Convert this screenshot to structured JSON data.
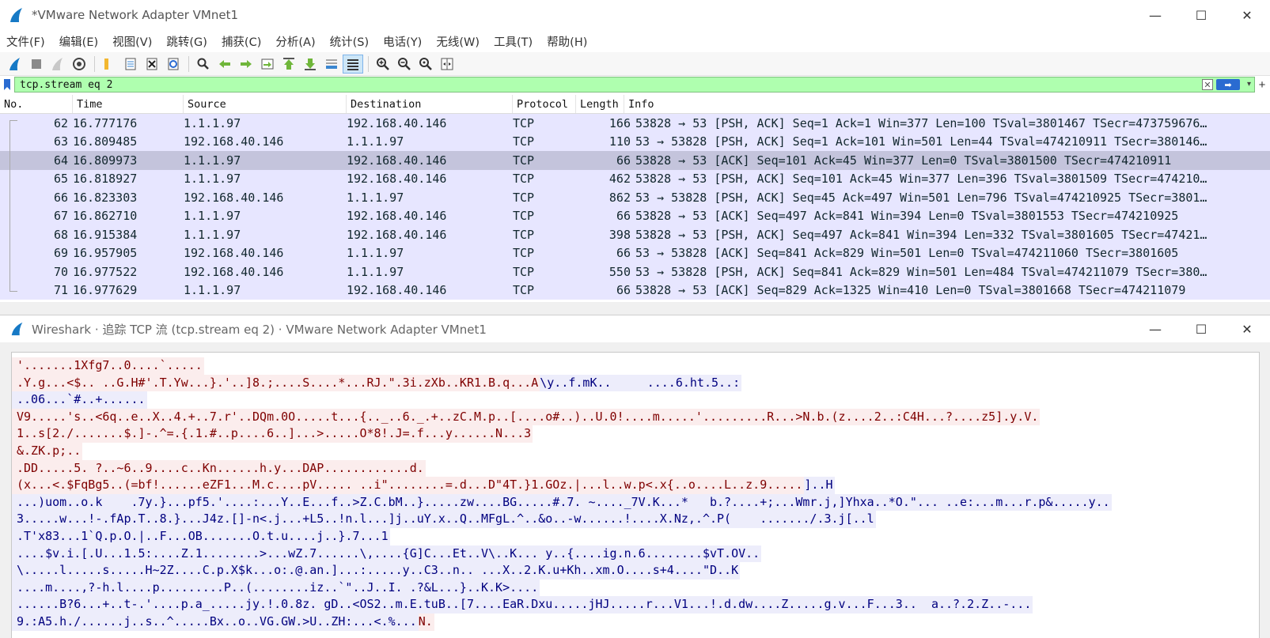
{
  "window": {
    "title": "*VMware Network Adapter VMnet1",
    "minimize": "—",
    "maximize": "☐",
    "close": "✕"
  },
  "menu": [
    "文件(F)",
    "编辑(E)",
    "视图(V)",
    "跳转(G)",
    "捕获(C)",
    "分析(A)",
    "统计(S)",
    "电话(Y)",
    "无线(W)",
    "工具(T)",
    "帮助(H)"
  ],
  "toolbar": {
    "icons": [
      "shark-start-icon",
      "stop-square-icon",
      "restart-fin-icon",
      "capture-options-gear-icon",
      "open-folder-icon",
      "save-file-icon",
      "close-file-icon",
      "reload-icon",
      "find-magnifier-icon",
      "go-back-arrow-icon",
      "go-forward-arrow-icon",
      "go-to-packet-icon",
      "go-first-icon",
      "go-last-icon",
      "autoscroll-icon",
      "colorize-icon",
      "zoom-in-icon",
      "zoom-out-icon",
      "zoom-normal-icon",
      "resize-columns-icon"
    ]
  },
  "filter": {
    "value": "tcp.stream eq 2",
    "background": "#afffaf"
  },
  "packet_list": {
    "columns": [
      "No.",
      "Time",
      "Source",
      "Destination",
      "Protocol",
      "Length",
      "Info"
    ],
    "selected_no": "64",
    "rows": [
      {
        "no": "62",
        "time": "16.777176",
        "src": "1.1.1.97",
        "dst": "192.168.40.146",
        "proto": "TCP",
        "len": "166",
        "info": "53828 → 53 [PSH, ACK] Seq=1 Ack=1 Win=377 Len=100 TSval=3801467 TSecr=473759676…"
      },
      {
        "no": "63",
        "time": "16.809485",
        "src": "192.168.40.146",
        "dst": "1.1.1.97",
        "proto": "TCP",
        "len": "110",
        "info": "53 → 53828 [PSH, ACK] Seq=1 Ack=101 Win=501 Len=44 TSval=474210911 TSecr=380146…"
      },
      {
        "no": "64",
        "time": "16.809973",
        "src": "1.1.1.97",
        "dst": "192.168.40.146",
        "proto": "TCP",
        "len": "66",
        "info": "53828 → 53 [ACK] Seq=101 Ack=45 Win=377 Len=0 TSval=3801500 TSecr=474210911"
      },
      {
        "no": "65",
        "time": "16.818927",
        "src": "1.1.1.97",
        "dst": "192.168.40.146",
        "proto": "TCP",
        "len": "462",
        "info": "53828 → 53 [PSH, ACK] Seq=101 Ack=45 Win=377 Len=396 TSval=3801509 TSecr=474210…"
      },
      {
        "no": "66",
        "time": "16.823303",
        "src": "192.168.40.146",
        "dst": "1.1.1.97",
        "proto": "TCP",
        "len": "862",
        "info": "53 → 53828 [PSH, ACK] Seq=45 Ack=497 Win=501 Len=796 TSval=474210925 TSecr=3801…"
      },
      {
        "no": "67",
        "time": "16.862710",
        "src": "1.1.1.97",
        "dst": "192.168.40.146",
        "proto": "TCP",
        "len": "66",
        "info": "53828 → 53 [ACK] Seq=497 Ack=841 Win=394 Len=0 TSval=3801553 TSecr=474210925"
      },
      {
        "no": "68",
        "time": "16.915384",
        "src": "1.1.1.97",
        "dst": "192.168.40.146",
        "proto": "TCP",
        "len": "398",
        "info": "53828 → 53 [PSH, ACK] Seq=497 Ack=841 Win=394 Len=332 TSval=3801605 TSecr=47421…"
      },
      {
        "no": "69",
        "time": "16.957905",
        "src": "192.168.40.146",
        "dst": "1.1.1.97",
        "proto": "TCP",
        "len": "66",
        "info": "53 → 53828 [ACK] Seq=841 Ack=829 Win=501 Len=0 TSval=474211060 TSecr=3801605"
      },
      {
        "no": "70",
        "time": "16.977522",
        "src": "192.168.40.146",
        "dst": "1.1.1.97",
        "proto": "TCP",
        "len": "550",
        "info": "53 → 53828 [PSH, ACK] Seq=841 Ack=829 Win=501 Len=484 TSval=474211079 TSecr=380…"
      },
      {
        "no": "71",
        "time": "16.977629",
        "src": "1.1.1.97",
        "dst": "192.168.40.146",
        "proto": "TCP",
        "len": "66",
        "info": "53828 → 53 [ACK] Seq=829 Ack=1325 Win=410 Len=0 TSval=3801668 TSecr=474211079"
      }
    ]
  },
  "follow_stream": {
    "title": "Wireshark · 追踪 TCP 流 (tcp.stream eq 2) · VMware Network Adapter VMnet1",
    "client_color": "#7f0000",
    "server_color": "#00007f",
    "lines": [
      {
        "dir": "client",
        "text": "'.......1Xfg7..0....`....."
      },
      {
        "dir": "client",
        "text": ".Y.g...<$.. ..G.H#'.T.Yw...}.'..]8.;....S....*...RJ.\".3i.zXb..KR1.B.q...A",
        "tail": "\\y..f.mK..     ....6.ht.5..:"
      },
      {
        "dir": "server",
        "text": "..06...`#..+......"
      },
      {
        "dir": "client",
        "text": "V9.....'s..<6q..e..X..4.+..7.r'..DQm.0O.....t...{.._..6._.+..zC.M.p..[....o#..)..U.0!....m.....'.........R...>N.b.(z....2..:C4H...?....z5].y.V."
      },
      {
        "dir": "client",
        "text": "1..s[2./.......$.]-.^=.{.1.#..p....6..]...>.....O*8!.J=.f...y......N...3"
      },
      {
        "dir": "client",
        "text": "&.ZK.p;.."
      },
      {
        "dir": "client",
        "text": ".DD.....5. ?..~6..9....c..Kn......h.y...DAP............d."
      },
      {
        "dir": "client",
        "text": "(x...<.$FqBg5..(=bf!......eZF1...M.c....pV..... ..i\"........=.d...D\"4T.}1.GOz.|...l..w.p<.x{..o....L..z.9.....",
        "tail": "]..H"
      },
      {
        "dir": "server",
        "text": "...)uom..o.k    .7y.}...pf5.'....:...Y..E...f..>Z.C.bM..}.....zw....BG.....#.7. ~...._7V.K...*   b.?....+;...Wmr.j,]Yhxa..*O.\"... ..e:...m...r.p&.....y.."
      },
      {
        "dir": "server",
        "text": "3.....w...!-.fAp.T..8.}...J4z.[]-n<.j...+L5..!n.l...]j..uY.x..Q..MFgL.^..&o..-w......!....X.Nz,.^.P(    ......./.3.j[..l"
      },
      {
        "dir": "server",
        "text": ".T'x83...1`Q.p.O.|..F...OB.......O.t.u....j..}.7...1"
      },
      {
        "dir": "server",
        "text": "....$v.i.[.U...1.5:....Z.1........>...wZ.7......\\,....{G]C...Et..V\\..K... y..{....ig.n.6........$vT.OV.."
      },
      {
        "dir": "server",
        "text": "\\.....l.....s.....H~2Z....C.p.X$k...o:.@.an.]...:.....y..C3..n.. ...X..2.K.u+Kh..xm.O....s+4....\"D..K"
      },
      {
        "dir": "server",
        "text": "....m....,?-h.l....p.........P..(........iz..`\"..J..I. .?&L...}..K.K>...."
      },
      {
        "dir": "server",
        "text": "......B?6...+..t-.'....p.a_.....jy.!.0.8z. gD..<OS2..m.E.tuB..[7....EaR.Dxu.....jHJ.....r...V1...!.d.dw....Z.....g.v...F...3..  a..?.2.Z..-..."
      },
      {
        "dir": "server",
        "text": "9.:A5.h./......j..s..^.....Bx..o..VG.GW.>U..ZH:...<.%...",
        "tail_client": "N."
      }
    ]
  }
}
